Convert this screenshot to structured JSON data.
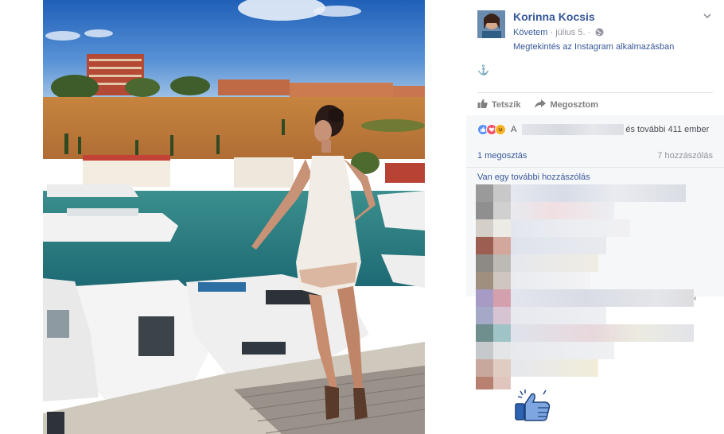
{
  "post": {
    "author": "Korinna Kocsis",
    "follow_label": "Követem",
    "separator": "·",
    "date": "július 5.",
    "separator2": "·",
    "app_link": "Megtekintés az Instagram alkalmazásban",
    "caption": "⚓"
  },
  "actions": {
    "like_label": "Tetszik",
    "share_label": "Megosztom"
  },
  "reactions": {
    "prefix": "A",
    "others_text": "és további 411 ember",
    "shares": "1 megosztás",
    "comments": "7 hozzászólás",
    "more_comments": "Van egy további hozzászólás"
  },
  "stray_glyph": "‹",
  "colors": {
    "link": "#365899",
    "muted": "#90949c",
    "like_blue": "#5890ff",
    "love_red": "#f25268",
    "haha_yellow": "#f7b125"
  },
  "icons": {
    "like": "thumbs-up-icon",
    "share": "share-arrow-icon",
    "globe": "globe-icon",
    "chevron": "chevron-down-icon",
    "sticker": "like-sticker-icon"
  }
}
